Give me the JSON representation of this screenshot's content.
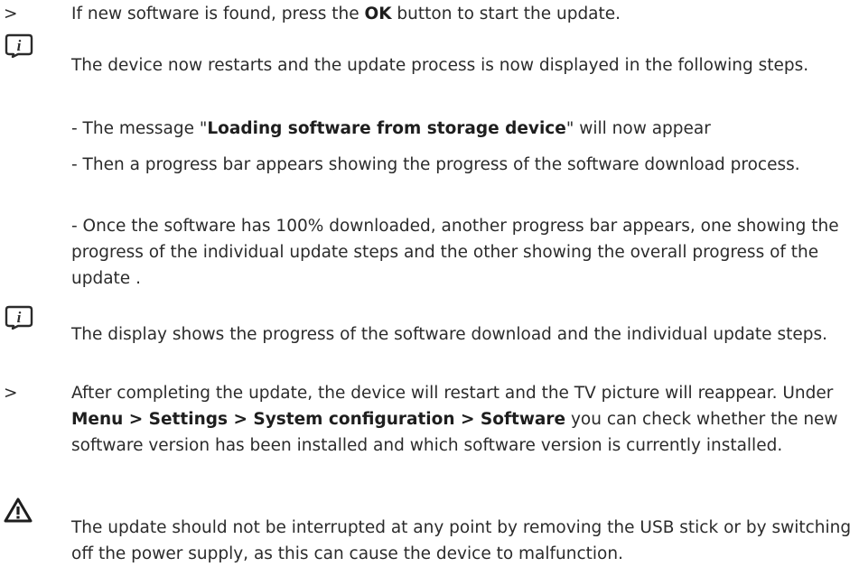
{
  "doc": {
    "step1": {
      "marker": ">",
      "pre": "If new software is found, press the ",
      "bold": "OK",
      "post": " button to start the update."
    },
    "note1": {
      "icon": "info-icon",
      "text": "The device now restarts and the update process is now displayed in the following steps.",
      "sub1_pre": "- The message \"",
      "sub1_bold": "Loading software from storage device",
      "sub1_post": "\" will now appear",
      "sub2": "- Then a progress bar appears showing the progress of the software download process.",
      "sub3": "- Once the software has 100% downloaded, another progress bar appears, one showing the progress of the individual update steps and the other showing the overall progress of the update ."
    },
    "note2": {
      "icon": "info-icon",
      "text": "The display shows the progress of the software download and the individual update steps."
    },
    "step2": {
      "marker": ">",
      "pre": "After completing the update, the device will restart and the TV picture will reappear. Under ",
      "bold": "Menu > Settings > System configuration > Software",
      "post": " you can check whether the new software version has been installed and which software version is currently installed."
    },
    "warning": {
      "icon": "warning-icon",
      "text": "The update should not be interrupted at any point by removing the USB stick or by switching off the power supply, as this can cause the device to malfunction."
    }
  }
}
